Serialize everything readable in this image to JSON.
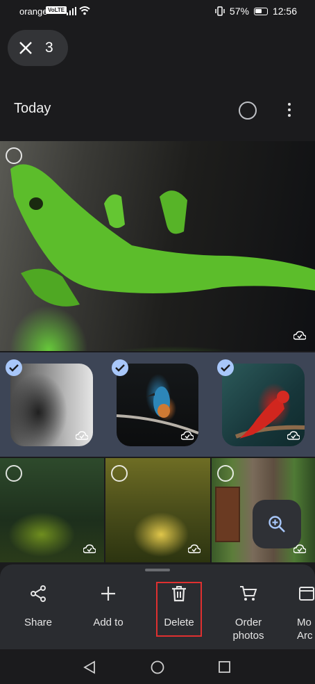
{
  "status_bar": {
    "carrier": "orange",
    "volte": "VoLTE",
    "battery": "57%",
    "time": "12:56"
  },
  "selection": {
    "count": "3",
    "close_icon": "close-icon"
  },
  "header": {
    "title": "Today"
  },
  "photos": [
    {
      "subject": "green lizard",
      "selected": false
    },
    {
      "subject": "horse",
      "selected": true
    },
    {
      "subject": "kingfisher",
      "selected": true
    },
    {
      "subject": "red parrot",
      "selected": true
    },
    {
      "subject": "forest",
      "selected": false
    },
    {
      "subject": "tree",
      "selected": false
    },
    {
      "subject": "ivy covered door",
      "selected": false
    }
  ],
  "actions": [
    {
      "label": "Share",
      "icon": "share-icon"
    },
    {
      "label": "Add to",
      "icon": "plus-icon"
    },
    {
      "label": "Delete",
      "icon": "trash-icon"
    },
    {
      "label": "Order\nphotos",
      "icon": "cart-icon"
    },
    {
      "label": "Mo\nArc",
      "icon": "archive-icon"
    }
  ],
  "colors": {
    "selection_bg": "#3d4556",
    "check": "#a8c7fa",
    "highlight": "#e03030"
  }
}
